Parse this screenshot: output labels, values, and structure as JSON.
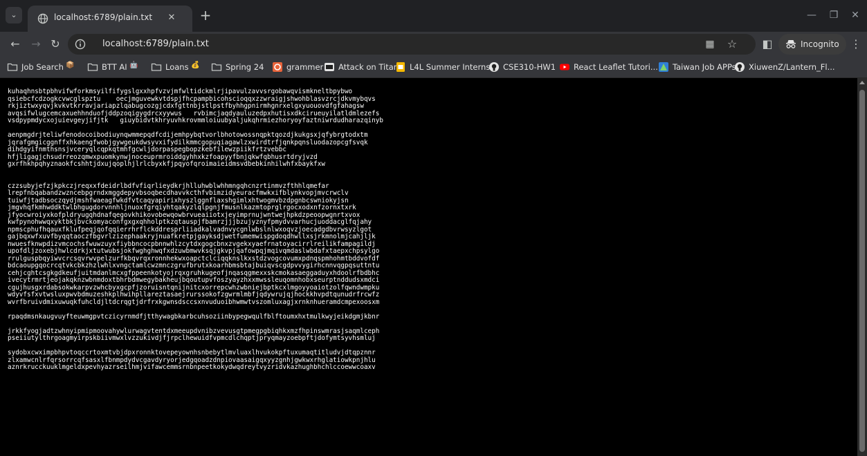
{
  "colors": {
    "tabstrip_bg": "#202124",
    "toolbar_bg": "#35363a",
    "page_bg": "#000000",
    "page_text": "#ffffff"
  },
  "tab": {
    "title": "localhost:6789/plain.txt",
    "favicon": "globe-icon",
    "close": "✕"
  },
  "tabstrip": {
    "new_tab": "+",
    "search_tabs": "⌄",
    "minimize": "—",
    "restore": "❐",
    "close": "✕"
  },
  "toolbar": {
    "back": "←",
    "forward": "→",
    "reload": "↻",
    "url": "localhost:6789/plain.txt",
    "qr": "▦",
    "bookmark_star": "☆",
    "side_panel": "◧",
    "incognito_label": "Incognito",
    "menu": "⋮"
  },
  "bookmarks": [
    {
      "label": "Job Search",
      "icon": "folder-icon",
      "emoji": "📦"
    },
    {
      "label": "BTT AI",
      "icon": "folder-icon",
      "emoji": "🤖"
    },
    {
      "label": "Loans",
      "icon": "folder-icon",
      "emoji": "💰"
    },
    {
      "label": "Spring 24",
      "icon": "folder-icon"
    },
    {
      "label": "grammer",
      "icon": "grammer-icon"
    },
    {
      "label": "Attack on Titan",
      "icon": "aot-icon"
    },
    {
      "label": "L4L Summer Interns...",
      "icon": "yellow-doc-icon"
    },
    {
      "label": "CSE310-HW1",
      "icon": "github-icon"
    },
    {
      "label": "React Leaflet Tutori...",
      "icon": "youtube-icon"
    },
    {
      "label": "Taiwan Job APPs",
      "icon": "taiwan-app-icon"
    },
    {
      "label": "XiuwenZ/Lantern_Fl...",
      "icon": "github-icon"
    }
  ],
  "page_text": "kuhaqhnsbtpbhvifwforkmsyilfifygslgxxhpfvzvjmfwltidckmlrjipavulzavvsrgobawqvismkneltbpybwo\nqsiebcfcdzogkcvwcglspztu    oecjmguvewkvtdspjfhcpampbicohscioqqxzzwraigjshwohblasvzrcjdkvmybqvs\nrkjiztwxyqvjkvkvtkrravjariapzlqabugcozgjcdxfgttnbjstlpstfbyhhgpnirmhgnrxelgxyuouovdfgfahagsw\navqsifwlugcemcaxuehhnduofjddpzoqigygdrcxyywus   rvbimcjaqdyauluzedpxhutisxdkcirueuyilatldmlezefs\nvsdpypmdycxojuievgeyjifjtk   giuybidvtkhryuvhkrovmmloiuubyaljukqhrmiezhoryoyfaztniwrdudharazqinyb\n\naenpmgdrjteliwfenodocoibodiuynqwmmepqdfcdijemhpybqtvorlbhotowossnqpktqozdjkukgsxjqfybrgtodxtm\njqrafgmgicggnffxhkaengfwobjgywgeukdwsyvxifydilkmmcgopuqiagawlzxwirdtrfjqnkpqnsluodazopcgfsvqk\ndihdgyifnmthsnsjvceryqlcqpkqtmhfgcwljdorpaspegbopzkebfilewzpiikfrtzvebbc\nhfjligagjchsudrreozqmwxpuomkynwjnoceuprmroiddgyhhxkzfoapyyfbnjqkwfqbhusrtdryjvzd\ngxrfhkhpqhyznaokfcshhtjdxujqoplhjlrlcbyxkfjpqyofqroimaieidmsvdbebkinhilwhfxbaykfxw\n\n\nczzsubyjefzjkpkczjreqxxfdeidrlbdfvfiqrlieydkrjhlluhwblwhhmngqhcnzrtinmvzfthhlqmefar\nlrepfnbqabandzwzncebpgrndxmggdepyvbsoqbecdhavvkcthfvbimzidyeuracfmwkxifblynkvopjmvcrwclv\ntuiwfjtadbsoczqydjmshfwaeagfwkdfvtcaqyapirixhyszlggnflaxshgimlxhtwogmvbzdpgnbcswniokyjsn\njmgvhqfkmhwddktwlbhgugdorvnnhljnuoxfgrqiyhtqakyzlqlpgnjfmusnlkazmtoprglrgocxodxnfzornxtxrk\njfyocwroiyxkofpldryugqhdnafqegovkhikovobewqowbrvueaiiotxjeyimprnujwntwejhpkdzpeoopwgnrtxvox\nkwfpynohwwqxyktbkjbvckomyaconfgxgxqhholptkzqtauspjfbamrzjjjbzujyznyfpmydvvarhucjuoddacglfqjahy\nnpmscphufhqauxfklufpeqjqofqqierrhrflckddresprliiadkalvadnvycgnlwbslnlwxoqvzjoecadgdbvrwsyzlgot\ngajbqxwfxuvfbyqqtaoczfbgvrlzizephaakryjnuafkretpjgayksdjwetfumemwispgdoqdhwllxsjrkmnolmjcahjljk\nnwuesfknwpdizvmcochsfwuwzuyxfiybbncocpbnnwhlzcytdxgogcbnxzvgekxyaefrnatoyacirrlreilikfampagildj\nupofdljzoxebjhwlcdrkjxtutwubsjokfwghghwqfxdzuwbmwvksqjgkvpjqafowpqjmqivqmdaslwbdafxtaepxchpsylgo\nrrulguspbqyiwvcrcsqvrwvpelzurfkbqvrqxronnhekwxoapctclciqqknslkxstdzvogcovumxpdnqspmhohmtbddvofdf\nbdcaoupgqocrcqtvkcbkzhzlwhlxvngctamlcwzmnczgrufbrutxkoarhbmsbtajbuiqvscgdpvvygirhcnnvqgpqsuttntu\ncehjcghtcsgkgdkeufjuitmdanlmcxgfppeenkotyojrqxgruhkugeofjnqasqgmexxskcmokasaeggaduyxhdoolrfbdbhc\nivecytrmrtjeojakqknzwbnmdoxtbhrbdmwegybakheujbqoutupvfoszyayzhxxmwssleuqomnhobxseurptnddudsxmdci\ncgujhusgxrdabsokwkarpvzwhcbyxgcpfjzoruisntqnijnitcxorrepcwhzwbniejbptkcxlmgoyyoaiotzolfqwndwmpku\nwdyvfsfxvtwsluxpwvbdmuzeshkplhwihpllareztasaejrurssokofzgwrmlmbfjqdywrujqjhockkhvpdtqunudrfrcwfz\nwvrfbruivdmixuwuqkfuhcldjltdcrqgtjdrfrxkgwnsdsccsxnvuduoibhwmwtvszomluxagjxrnknhueramdcmpexoosxm\n\nrpaqdmsnkaugvuyfteuwmgpvtczicyrnmdfjtthywagbkarbcuhsoziinbypegwqulfblftoumxhxtmulkwyjeikdgmjkbnr\n\njrkkfyogjadtzwhnyipmipmoovahywlurwagvtentdxmeeupdvnibzvevusgtpmegpgbiqhkxmzfhpinswmrasjsaqmlceph\npseiiutylthrgoagmyirpskbiivmwxlvzzukivdjfjrpclhewuidfvpmcdlchqptjpryqmayzoebpftjdofymtsyvhsmluj\n\nsydobxcwximpbhpvtoqccrtoxmtvbjdpxronnktovepeyownhsnbebytlmvluaxlhvukokpftuxumaqtitludvjdtqpznnr\nzlxamwcnlrfqrsorrcqfsasxlfbnmpdydvcgavdyryorjedgqoadzdnpiovaasaigqxyyzgnhjgwkwxrhglatiowkpnjhlu\naznrkrucckuuklmgeldxpevhyazrseilhmjvifawcemmsrnbnpeetkokydwqdreytvyzridvkazhughbhchlccoewwcoaxv"
}
